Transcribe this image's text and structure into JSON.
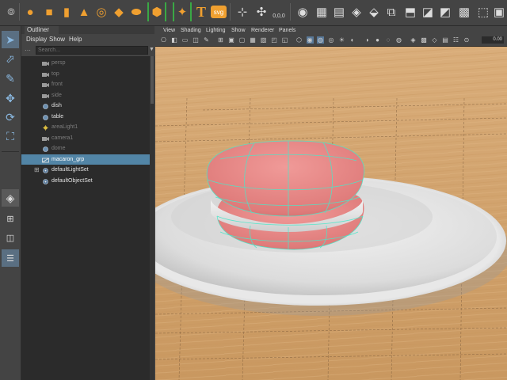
{
  "outliner": {
    "tab_label": "Outliner",
    "menu": [
      "Display",
      "Show",
      "Help"
    ],
    "search_placeholder": "Search...",
    "items": [
      {
        "label": "persp",
        "icon": "camera-icon",
        "state": "dim"
      },
      {
        "label": "top",
        "icon": "camera-icon",
        "state": "dim"
      },
      {
        "label": "front",
        "icon": "camera-icon",
        "state": "dim"
      },
      {
        "label": "side",
        "icon": "camera-icon",
        "state": "dim"
      },
      {
        "label": "dish",
        "icon": "transform-icon",
        "state": "normal"
      },
      {
        "label": "table",
        "icon": "transform-icon",
        "state": "normal"
      },
      {
        "label": "areaLight1",
        "icon": "area-light-icon",
        "state": "dim"
      },
      {
        "label": "camera1",
        "icon": "camera-icon",
        "state": "dim"
      },
      {
        "label": "dome",
        "icon": "transform-icon",
        "state": "dim"
      },
      {
        "label": "macaron_grp",
        "icon": "group-icon",
        "state": "selected"
      },
      {
        "label": "defaultLightSet",
        "icon": "set-icon",
        "state": "normal"
      },
      {
        "label": "defaultObjectSet",
        "icon": "set-icon",
        "state": "normal"
      }
    ]
  },
  "viewport": {
    "menu": [
      "View",
      "Shading",
      "Lighting",
      "Show",
      "Renderer",
      "Panels"
    ],
    "field_value": "0.00"
  },
  "shelf": {
    "icons": [
      "polygon-sphere-icon",
      "polygon-cube-icon",
      "polygon-cylinder-icon",
      "polygon-cone-icon",
      "polygon-torus-icon",
      "polygon-plane-icon",
      "polygon-disc-icon",
      "platonic-icon",
      "super-shape-icon",
      "sphere-sweep-icon",
      "platonic-cube-icon",
      "text-icon",
      "svg-icon",
      "snap-icon",
      "uv-icon",
      "uvw-icon",
      "combine-icon",
      "separate-icon",
      "extract-icon",
      "smooth-icon",
      "bevel-icon",
      "bridge-icon",
      "extrude-icon",
      "multicut-icon"
    ],
    "text_label": "T",
    "svg_label": "svg",
    "coord_label": "0,0,0"
  },
  "colors": {
    "selection": "#5285a6",
    "macaron": "#e07d7d",
    "wireframe": "#4ce6c8",
    "wood": "#d5a673"
  }
}
